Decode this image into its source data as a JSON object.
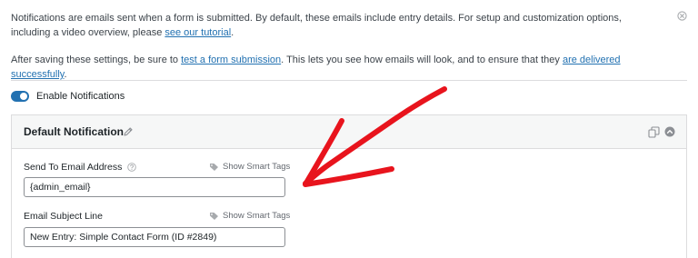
{
  "notice": {
    "line1_text": "Notifications are emails sent when a form is submitted. By default, these emails include entry details. For setup and customization options, including a video overview, please ",
    "line1_link": "see our tutorial",
    "line1_end": ".",
    "line2_text": "After saving these settings, be sure to ",
    "line2_link1": "test a form submission",
    "line2_middle": ". This lets you see how emails will look, and to ensure that they ",
    "line2_link2": "are delivered successfully",
    "line2_end": "."
  },
  "toggle": {
    "label": "Enable Notifications",
    "enabled": true
  },
  "panel": {
    "title": "Default Notification"
  },
  "fields": {
    "send_to": {
      "label": "Send To Email Address",
      "smart_tags": "Show Smart Tags",
      "value": "{admin_email}"
    },
    "subject": {
      "label": "Email Subject Line",
      "smart_tags": "Show Smart Tags",
      "value": "New Entry: Simple Contact Form (ID #2849)"
    }
  },
  "colors": {
    "link": "#2271b1",
    "toggle_on": "#2271b1",
    "annotation": "#e8141d"
  },
  "icons": {
    "dismiss": "close-circle-icon",
    "edit": "pencil-icon",
    "clone": "duplicate-icon",
    "collapse": "chevron-up-circle-icon",
    "help": "question-circle-icon",
    "tag": "tag-icon",
    "annotation": "hand-drawn-arrow"
  }
}
